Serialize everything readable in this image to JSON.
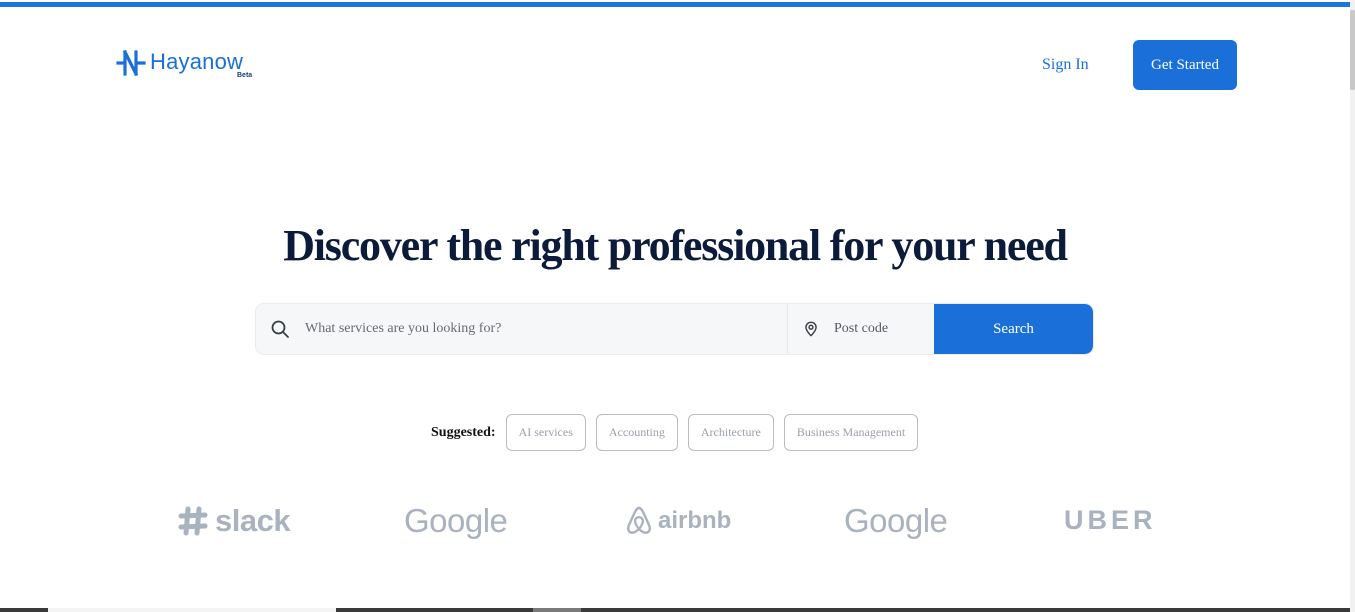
{
  "header": {
    "logo_text": "Hayanow",
    "logo_badge": "Beta",
    "sign_in": "Sign In",
    "get_started": "Get Started"
  },
  "hero": {
    "title": "Discover the right professional for your need"
  },
  "search": {
    "service_placeholder": "What services are you looking for?",
    "postcode_placeholder": "Post code",
    "button_label": "Search"
  },
  "suggested": {
    "label": "Suggested:",
    "chips": [
      "AI services",
      "Accounting",
      "Architecture",
      "Business Management"
    ]
  },
  "brands": [
    "slack",
    "Google",
    "airbnb",
    "Google",
    "UBER"
  ],
  "colors": {
    "primary": "#1a6fd9",
    "heading": "#0d1b3a",
    "brand_gray": "#a9b3bf"
  }
}
